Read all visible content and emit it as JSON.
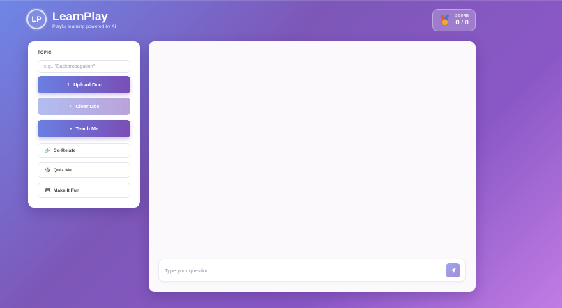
{
  "header": {
    "logo_text": "LP",
    "title": "LearnPlay",
    "subtitle": "Playful learning powered by AI",
    "score": {
      "label": "SCORE",
      "value": "0 / 0",
      "icon": "medal-icon"
    }
  },
  "sidebar": {
    "topic_label": "TOPIC",
    "topic_placeholder": "e.g., \"Backpropagation\"",
    "topic_value": "",
    "buttons": [
      {
        "label": "Upload Doc",
        "icon": "upload-icon",
        "state": "enabled"
      },
      {
        "label": "Clear Doc",
        "icon": "trash-icon",
        "state": "disabled"
      },
      {
        "label": "Teach Me",
        "icon": "teacher-icon",
        "state": "enabled"
      }
    ],
    "options": [
      {
        "label": "Co-Relate",
        "icon": "link-icon"
      },
      {
        "label": "Quiz Me",
        "icon": "dice-icon"
      },
      {
        "label": "Make It Fun",
        "icon": "gamepad-icon"
      }
    ]
  },
  "chat": {
    "messages": [],
    "input_placeholder": "Type your question...",
    "input_value": "",
    "send_icon": "send-icon"
  },
  "colors": {
    "accent_start": "#6a7fe2",
    "accent_end": "#7a4eb5",
    "background_start": "#6f86e6",
    "background_end": "#c17ce4"
  }
}
